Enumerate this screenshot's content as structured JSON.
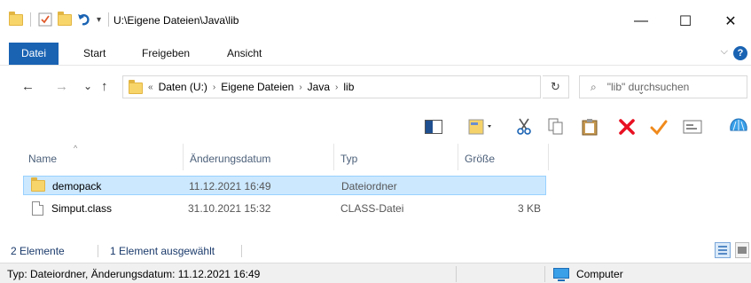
{
  "window": {
    "title": "U:\\Eigene Dateien\\Java\\lib",
    "minimize": "—",
    "maximize": "☐",
    "close": "✕"
  },
  "ribbon": {
    "tabs": [
      "Datei",
      "Start",
      "Freigeben",
      "Ansicht"
    ],
    "help": "?",
    "collapse": "⌵"
  },
  "nav": {
    "back": "←",
    "forward": "→",
    "recent": "⌄",
    "up": "↑",
    "overflow": "«",
    "breadcrumbs": [
      "Daten (U:)",
      "Eigene Dateien",
      "Java",
      "lib"
    ],
    "separator": "›",
    "dropdown": "⌄",
    "refresh": "↻",
    "search_placeholder": "\"lib\" durchsuchen"
  },
  "columns": [
    "Name",
    "Änderungsdatum",
    "Typ",
    "Größe"
  ],
  "files": [
    {
      "name": "demopack",
      "date": "11.12.2021 16:49",
      "type": "Dateiordner",
      "size": "",
      "kind": "folder-icon",
      "selected": true
    },
    {
      "name": "Simput.class",
      "date": "31.10.2021 15:32",
      "type": "CLASS-Datei",
      "size": "3 KB",
      "kind": "file-icon",
      "selected": false
    }
  ],
  "counts": {
    "elements": "2 Elemente",
    "selected": "1 Element ausgewählt"
  },
  "status": {
    "info": "Typ: Dateiordner, Änderungsdatum: 11.12.2021 16:49",
    "location": "Computer"
  },
  "colors": {
    "accent": "#1a63b3",
    "selection": "#cce8ff",
    "delete_red": "#e81123",
    "check_orange": "#f08a1c"
  }
}
